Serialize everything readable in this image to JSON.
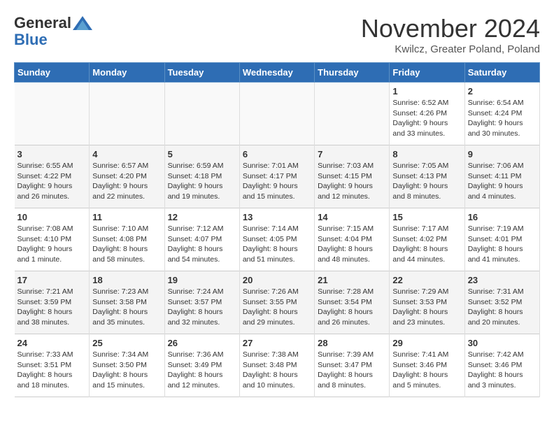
{
  "header": {
    "logo_general": "General",
    "logo_blue": "Blue",
    "title": "November 2024",
    "location": "Kwilcz, Greater Poland, Poland"
  },
  "weekdays": [
    "Sunday",
    "Monday",
    "Tuesday",
    "Wednesday",
    "Thursday",
    "Friday",
    "Saturday"
  ],
  "weeks": [
    [
      {
        "day": "",
        "data": ""
      },
      {
        "day": "",
        "data": ""
      },
      {
        "day": "",
        "data": ""
      },
      {
        "day": "",
        "data": ""
      },
      {
        "day": "",
        "data": ""
      },
      {
        "day": "1",
        "data": "Sunrise: 6:52 AM\nSunset: 4:26 PM\nDaylight: 9 hours and 33 minutes."
      },
      {
        "day": "2",
        "data": "Sunrise: 6:54 AM\nSunset: 4:24 PM\nDaylight: 9 hours and 30 minutes."
      }
    ],
    [
      {
        "day": "3",
        "data": "Sunrise: 6:55 AM\nSunset: 4:22 PM\nDaylight: 9 hours and 26 minutes."
      },
      {
        "day": "4",
        "data": "Sunrise: 6:57 AM\nSunset: 4:20 PM\nDaylight: 9 hours and 22 minutes."
      },
      {
        "day": "5",
        "data": "Sunrise: 6:59 AM\nSunset: 4:18 PM\nDaylight: 9 hours and 19 minutes."
      },
      {
        "day": "6",
        "data": "Sunrise: 7:01 AM\nSunset: 4:17 PM\nDaylight: 9 hours and 15 minutes."
      },
      {
        "day": "7",
        "data": "Sunrise: 7:03 AM\nSunset: 4:15 PM\nDaylight: 9 hours and 12 minutes."
      },
      {
        "day": "8",
        "data": "Sunrise: 7:05 AM\nSunset: 4:13 PM\nDaylight: 9 hours and 8 minutes."
      },
      {
        "day": "9",
        "data": "Sunrise: 7:06 AM\nSunset: 4:11 PM\nDaylight: 9 hours and 4 minutes."
      }
    ],
    [
      {
        "day": "10",
        "data": "Sunrise: 7:08 AM\nSunset: 4:10 PM\nDaylight: 9 hours and 1 minute."
      },
      {
        "day": "11",
        "data": "Sunrise: 7:10 AM\nSunset: 4:08 PM\nDaylight: 8 hours and 58 minutes."
      },
      {
        "day": "12",
        "data": "Sunrise: 7:12 AM\nSunset: 4:07 PM\nDaylight: 8 hours and 54 minutes."
      },
      {
        "day": "13",
        "data": "Sunrise: 7:14 AM\nSunset: 4:05 PM\nDaylight: 8 hours and 51 minutes."
      },
      {
        "day": "14",
        "data": "Sunrise: 7:15 AM\nSunset: 4:04 PM\nDaylight: 8 hours and 48 minutes."
      },
      {
        "day": "15",
        "data": "Sunrise: 7:17 AM\nSunset: 4:02 PM\nDaylight: 8 hours and 44 minutes."
      },
      {
        "day": "16",
        "data": "Sunrise: 7:19 AM\nSunset: 4:01 PM\nDaylight: 8 hours and 41 minutes."
      }
    ],
    [
      {
        "day": "17",
        "data": "Sunrise: 7:21 AM\nSunset: 3:59 PM\nDaylight: 8 hours and 38 minutes."
      },
      {
        "day": "18",
        "data": "Sunrise: 7:23 AM\nSunset: 3:58 PM\nDaylight: 8 hours and 35 minutes."
      },
      {
        "day": "19",
        "data": "Sunrise: 7:24 AM\nSunset: 3:57 PM\nDaylight: 8 hours and 32 minutes."
      },
      {
        "day": "20",
        "data": "Sunrise: 7:26 AM\nSunset: 3:55 PM\nDaylight: 8 hours and 29 minutes."
      },
      {
        "day": "21",
        "data": "Sunrise: 7:28 AM\nSunset: 3:54 PM\nDaylight: 8 hours and 26 minutes."
      },
      {
        "day": "22",
        "data": "Sunrise: 7:29 AM\nSunset: 3:53 PM\nDaylight: 8 hours and 23 minutes."
      },
      {
        "day": "23",
        "data": "Sunrise: 7:31 AM\nSunset: 3:52 PM\nDaylight: 8 hours and 20 minutes."
      }
    ],
    [
      {
        "day": "24",
        "data": "Sunrise: 7:33 AM\nSunset: 3:51 PM\nDaylight: 8 hours and 18 minutes."
      },
      {
        "day": "25",
        "data": "Sunrise: 7:34 AM\nSunset: 3:50 PM\nDaylight: 8 hours and 15 minutes."
      },
      {
        "day": "26",
        "data": "Sunrise: 7:36 AM\nSunset: 3:49 PM\nDaylight: 8 hours and 12 minutes."
      },
      {
        "day": "27",
        "data": "Sunrise: 7:38 AM\nSunset: 3:48 PM\nDaylight: 8 hours and 10 minutes."
      },
      {
        "day": "28",
        "data": "Sunrise: 7:39 AM\nSunset: 3:47 PM\nDaylight: 8 hours and 8 minutes."
      },
      {
        "day": "29",
        "data": "Sunrise: 7:41 AM\nSunset: 3:46 PM\nDaylight: 8 hours and 5 minutes."
      },
      {
        "day": "30",
        "data": "Sunrise: 7:42 AM\nSunset: 3:46 PM\nDaylight: 8 hours and 3 minutes."
      }
    ]
  ]
}
